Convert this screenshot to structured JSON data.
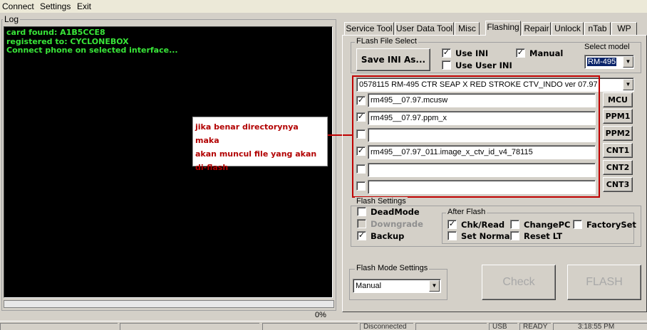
{
  "menu": [
    "Connect",
    "Settings",
    "Exit"
  ],
  "log": {
    "caption": "Log",
    "lines": [
      "card found: A1B5CCE8",
      "registered to: CYCLONEBOX",
      "",
      "Connect phone on selected interface..."
    ]
  },
  "annotation": [
    "jika benar directorynya maka",
    "akan muncul file yang akan",
    "di-flash"
  ],
  "progress": "0%",
  "status": {
    "connection": "Disconnected",
    "mode": "USB",
    "state": "READY",
    "time": "3:18:55 PM"
  },
  "tabs": [
    "Service Tool",
    "User Data Tool",
    "Misc",
    "Flashing",
    "Repair",
    "Unlock",
    "nTab",
    "WP"
  ],
  "active_tab": "Flashing",
  "flash_file_select": {
    "caption": "FLash File Select",
    "save_ini_label": "Save INI As...",
    "use_ini_label": "Use INI",
    "use_ini_checked": true,
    "use_user_ini_label": "Use User INI",
    "use_user_ini_checked": false,
    "manual_label": "Manual",
    "manual_checked": true,
    "select_model_label": "Select model",
    "model_value": "RM-495"
  },
  "package_value": "0578115 RM-495 CTR SEAP X RED STROKE CTV_INDO ver 07.97",
  "files": [
    {
      "checked": true,
      "value": "rm495__07.97.mcusw",
      "button": "MCU"
    },
    {
      "checked": true,
      "value": "rm495__07.97.ppm_x",
      "button": "PPM1"
    },
    {
      "checked": false,
      "value": "",
      "button": "PPM2"
    },
    {
      "checked": true,
      "value": "rm495__07.97_011.image_x_ctv_id_v4_78115",
      "button": "CNT1"
    },
    {
      "checked": false,
      "value": "",
      "button": "CNT2"
    },
    {
      "checked": false,
      "value": "",
      "button": "CNT3"
    }
  ],
  "flash_settings": {
    "caption": "Flash Settings",
    "deadmode_label": "DeadMode",
    "downgrade_label": "Downgrade",
    "backup_label": "Backup",
    "after_flash_caption": "After Flash",
    "chk_read_label": "Chk/Read",
    "change_pc_label": "ChangePC",
    "factory_set_label": "FactorySet",
    "set_normal_label": "Set Normal",
    "reset_lt_label": "Reset LT"
  },
  "flash_mode": {
    "caption": "Flash Mode Settings",
    "value": "Manual"
  },
  "actions": {
    "check_label": "Check",
    "flash_label": "FLASH"
  },
  "check_mark": "✓"
}
